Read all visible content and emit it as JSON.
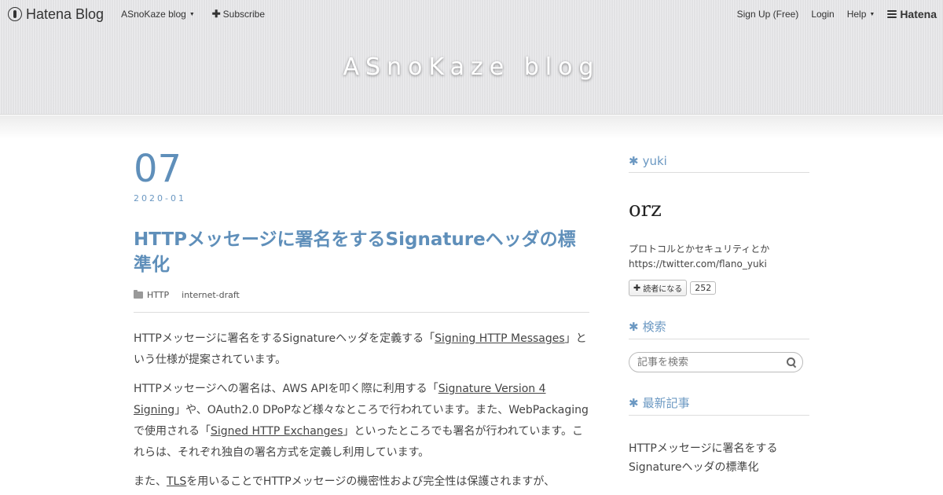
{
  "globalbar": {
    "logo_text": "Hatena Blog",
    "blog_menu": "ASnoKaze blog",
    "subscribe": "Subscribe",
    "signup": "Sign Up (Free)",
    "login": "Login",
    "help": "Help",
    "brand": "Hatena"
  },
  "header": {
    "title": "ASnoKaze blog"
  },
  "entry": {
    "day": "07",
    "year_month": "2020-01",
    "title": "HTTPメッセージに署名をするSignatureヘッダの標準化",
    "categories": [
      "HTTP",
      "internet-draft"
    ],
    "p1": {
      "before": "HTTPメッセージに署名をするSignatureヘッダを定義する「",
      "link": "Signing HTTP Messages",
      "after": "」という仕様が提案されています。"
    },
    "p2": {
      "before": "HTTPメッセージへの署名は、AWS APIを叩く際に利用する「",
      "link1": "Signature Version 4 Signing",
      "middle": "」や、OAuth2.0 DPoPなど様々なところで行われています。また、WebPackagingで使用される「",
      "link2": "Signed HTTP Exchanges",
      "after": "」といったところでも署名が行われています。これらは、それぞれ独自の署名方式を定義し利用しています。"
    },
    "p3": {
      "before": "また、",
      "link": "TLS",
      "after": "を用いることでHTTPメッセージの機密性および完全性は保護されますが、"
    }
  },
  "sidebar": {
    "profile": {
      "title": "yuki",
      "icon_text": "orz",
      "desc_line1": "プロトコルとかセキュリティとか",
      "desc_line2": "https://twitter.com/flano_yuki",
      "reader_button": "読者になる",
      "reader_count": "252"
    },
    "search": {
      "title": "検索",
      "placeholder": "記事を検索"
    },
    "recent": {
      "title": "最新記事",
      "items": [
        "HTTPメッセージに署名をする",
        "Signatureヘッダの標準化"
      ]
    }
  },
  "colors": {
    "accent": "#5f8fba",
    "text": "#444444"
  }
}
